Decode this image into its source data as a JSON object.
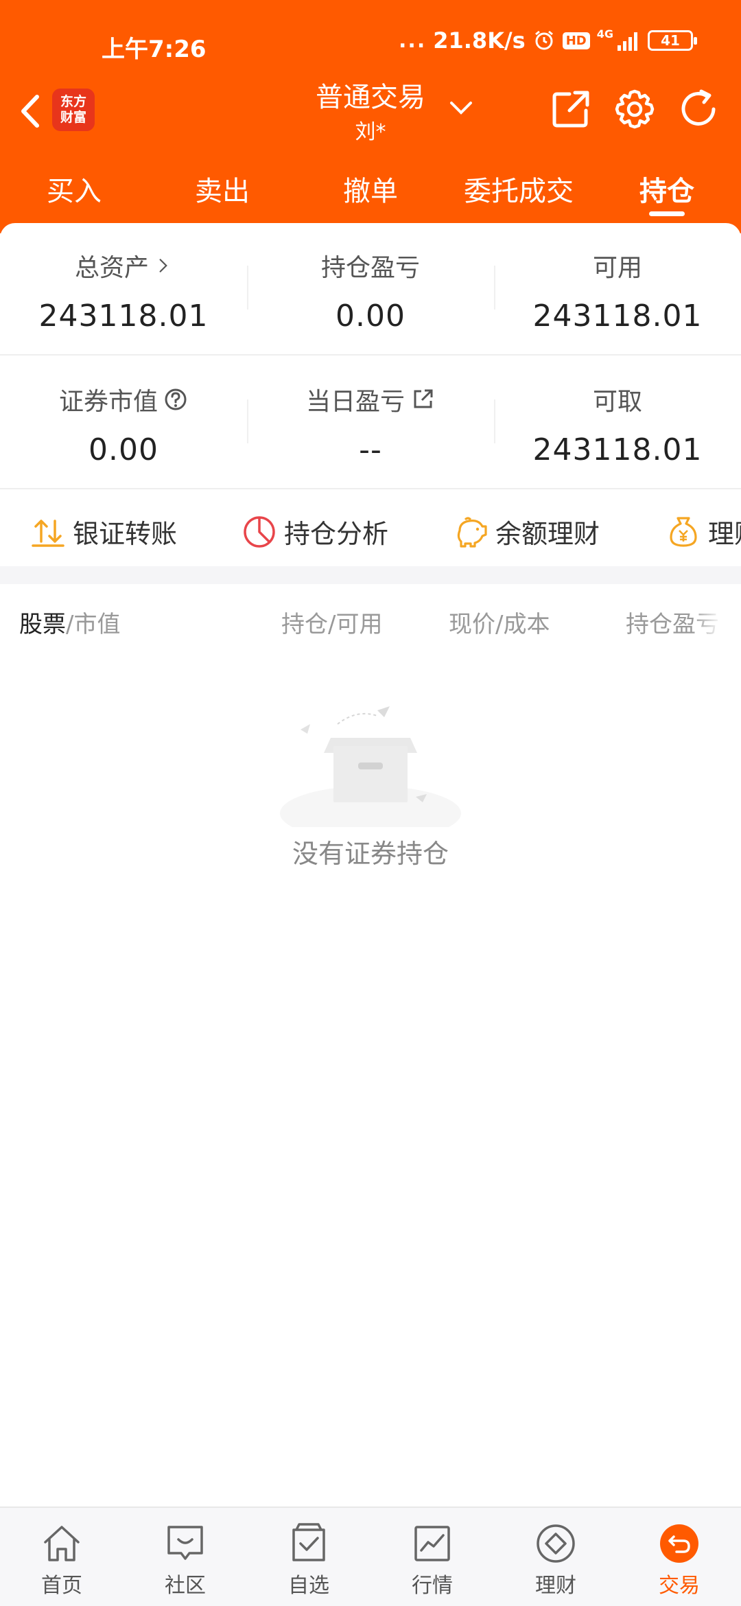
{
  "status_bar": {
    "time": "上午7:26",
    "dots": "...",
    "net_speed": "21.8K/s",
    "hd": "HD",
    "network": "4G",
    "battery": "41"
  },
  "nav": {
    "title": "普通交易",
    "account": "刘*",
    "logo_line1": "东方",
    "logo_line2": "财富"
  },
  "tabs": [
    {
      "label": "买入"
    },
    {
      "label": "卖出"
    },
    {
      "label": "撤单"
    },
    {
      "label": "委托成交"
    },
    {
      "label": "持仓",
      "active": true
    }
  ],
  "summary": {
    "total_assets": {
      "label": "总资产",
      "value": "243118.01"
    },
    "position_pnl": {
      "label": "持仓盈亏",
      "value": "0.00"
    },
    "available": {
      "label": "可用",
      "value": "243118.01"
    },
    "market_value": {
      "label": "证券市值",
      "value": "0.00"
    },
    "daily_pnl": {
      "label": "当日盈亏",
      "value": "--"
    },
    "withdrawable": {
      "label": "可取",
      "value": "243118.01"
    }
  },
  "quick_actions": [
    {
      "label": "银证转账",
      "icon": "transfer-icon"
    },
    {
      "label": "持仓分析",
      "icon": "pie-chart-icon"
    },
    {
      "label": "余额理财",
      "icon": "piggy-bank-icon"
    },
    {
      "label": "理财",
      "icon": "money-bag-icon"
    }
  ],
  "list_header": {
    "stock": "股票",
    "market_value": "/市值",
    "hold_available": "持仓/可用",
    "price_cost": "现价/成本",
    "position_pnl": "持仓盈亏"
  },
  "empty_state": {
    "text": "没有证券持仓"
  },
  "bottom_nav": [
    {
      "label": "首页",
      "icon": "home-icon"
    },
    {
      "label": "社区",
      "icon": "community-icon"
    },
    {
      "label": "自选",
      "icon": "watchlist-icon"
    },
    {
      "label": "行情",
      "icon": "market-icon"
    },
    {
      "label": "理财",
      "icon": "wealth-icon"
    },
    {
      "label": "交易",
      "icon": "trade-icon",
      "active": true
    }
  ],
  "colors": {
    "brand": "#FF5A00",
    "logo": "#E8351B",
    "transfer_icon": "#F5A623",
    "analysis_icon": "#E8454A",
    "wealth_icon": "#F5A623"
  }
}
